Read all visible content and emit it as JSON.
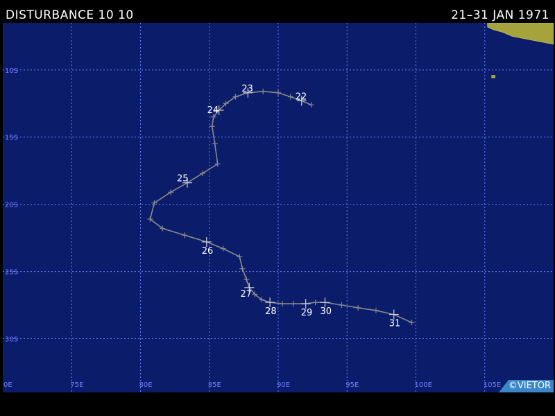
{
  "header": {
    "title": "DISTURBANCE 10 10",
    "date_range": "21–31 JAN 1971"
  },
  "credit": "©VIETOR",
  "map": {
    "colors": {
      "ocean": "#0b1c6b",
      "grid": "#6c80ff",
      "track": "#8a8a8a",
      "land": "#a6a33c",
      "labels": "#ffffff"
    },
    "lon_range": [
      70,
      110
    ],
    "lat_range": [
      -6.5,
      -34
    ],
    "gridlines": {
      "lon_step": 5,
      "lat_step": 5,
      "style": "dotted"
    },
    "lon_labels": [
      {
        "value": 70,
        "text": "0E"
      },
      {
        "value": 75,
        "text": "75E"
      },
      {
        "value": 80,
        "text": "80E"
      },
      {
        "value": 85,
        "text": "85E"
      },
      {
        "value": 90,
        "text": "90E"
      },
      {
        "value": 95,
        "text": "95E"
      },
      {
        "value": 100,
        "text": "100E"
      },
      {
        "value": 105,
        "text": "105E"
      }
    ],
    "lat_labels": [
      {
        "value": -10,
        "text": "10S"
      },
      {
        "value": -15,
        "text": "15S"
      },
      {
        "value": -20,
        "text": "20S"
      },
      {
        "value": -25,
        "text": "25S"
      },
      {
        "value": -30,
        "text": "30S"
      }
    ],
    "track": [
      {
        "lon": 92.4,
        "lat": -12.6
      },
      {
        "lon": 91.7,
        "lat": -12.3,
        "label": "22"
      },
      {
        "lon": 90.9,
        "lat": -12.0
      },
      {
        "lon": 90.0,
        "lat": -11.7
      },
      {
        "lon": 88.9,
        "lat": -11.6
      },
      {
        "lon": 87.8,
        "lat": -11.7,
        "label": "23"
      },
      {
        "lon": 86.9,
        "lat": -12.0
      },
      {
        "lon": 86.2,
        "lat": -12.5
      },
      {
        "lon": 85.7,
        "lat": -13.0,
        "label": "24"
      },
      {
        "lon": 85.3,
        "lat": -13.5
      },
      {
        "lon": 85.2,
        "lat": -14.2
      },
      {
        "lon": 85.4,
        "lat": -15.5
      },
      {
        "lon": 85.6,
        "lat": -17.0
      },
      {
        "lon": 84.5,
        "lat": -17.7
      },
      {
        "lon": 83.4,
        "lat": -18.4,
        "label": "25"
      },
      {
        "lon": 82.2,
        "lat": -19.1
      },
      {
        "lon": 81.0,
        "lat": -19.9
      },
      {
        "lon": 80.7,
        "lat": -21.1
      },
      {
        "lon": 81.6,
        "lat": -21.8
      },
      {
        "lon": 83.2,
        "lat": -22.3
      },
      {
        "lon": 84.8,
        "lat": -22.8,
        "label": "26"
      },
      {
        "lon": 86.0,
        "lat": -23.3
      },
      {
        "lon": 87.2,
        "lat": -23.9
      },
      {
        "lon": 87.4,
        "lat": -24.8
      },
      {
        "lon": 87.7,
        "lat": -25.6
      },
      {
        "lon": 87.9,
        "lat": -26.2,
        "label": "27"
      },
      {
        "lon": 88.3,
        "lat": -26.7
      },
      {
        "lon": 88.8,
        "lat": -27.1
      },
      {
        "lon": 89.4,
        "lat": -27.3,
        "label": "28"
      },
      {
        "lon": 90.3,
        "lat": -27.4
      },
      {
        "lon": 91.1,
        "lat": -27.4
      },
      {
        "lon": 92.0,
        "lat": -27.4,
        "label": "29"
      },
      {
        "lon": 92.7,
        "lat": -27.3
      },
      {
        "lon": 93.4,
        "lat": -27.3,
        "label": "30"
      },
      {
        "lon": 94.6,
        "lat": -27.5
      },
      {
        "lon": 95.8,
        "lat": -27.7
      },
      {
        "lon": 97.1,
        "lat": -27.9
      },
      {
        "lon": 98.4,
        "lat": -28.2,
        "label": "31"
      },
      {
        "lon": 99.7,
        "lat": -28.8
      }
    ],
    "land": [
      [
        [
          105.2,
          -6.5
        ],
        [
          110,
          -6.5
        ],
        [
          110,
          -8.1
        ],
        [
          109.0,
          -7.9
        ],
        [
          108.0,
          -7.7
        ],
        [
          107.0,
          -7.5
        ],
        [
          106.3,
          -7.2
        ],
        [
          105.6,
          -7.0
        ],
        [
          105.2,
          -6.8
        ]
      ],
      [
        [
          105.5,
          -10.4
        ],
        [
          105.75,
          -10.4
        ],
        [
          105.75,
          -10.6
        ],
        [
          105.5,
          -10.6
        ]
      ]
    ]
  }
}
